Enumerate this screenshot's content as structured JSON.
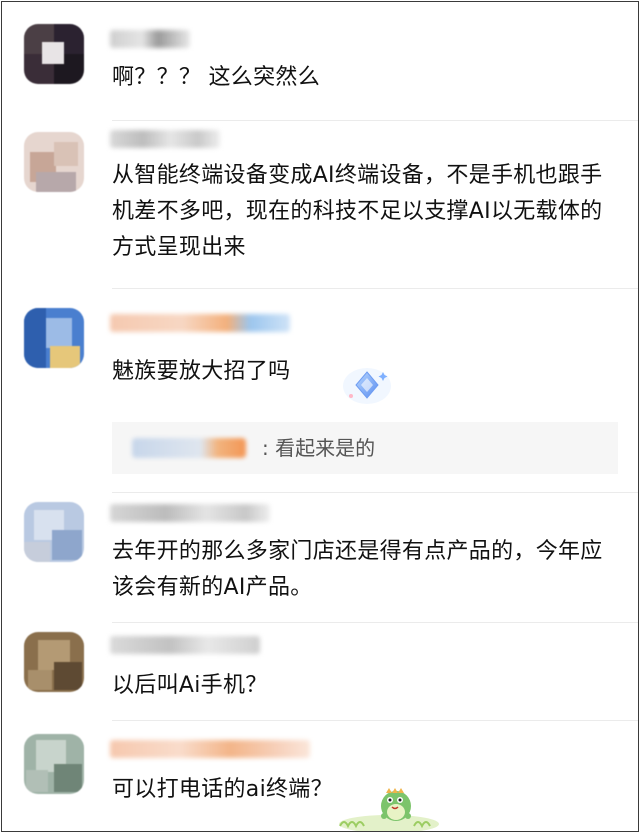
{
  "comments": [
    {
      "id": "c1",
      "text": "啊？？？ 这么突然么"
    },
    {
      "id": "c2",
      "text": "从智能终端设备变成AI终端设备，不是手机也跟手机差不多吧，现在的科技不足以支撑AI以无载体的方式呈现出来"
    },
    {
      "id": "c3",
      "text": "魅族要放大招了吗",
      "reply": {
        "text": ": 看起来是的"
      }
    },
    {
      "id": "c4",
      "text": "去年开的那么多家门店还是得有点产品的，今年应该会有新的AI产品。"
    },
    {
      "id": "c5",
      "text": "以后叫Ai手机？"
    },
    {
      "id": "c6",
      "text": "可以打电话的ai终端？"
    }
  ],
  "icons": {
    "badge": "diamond-sparkle-icon",
    "sticker": "green-dinosaur-sticker-icon"
  },
  "colors": {
    "accent_orange": "#f39655",
    "reply_bg": "#f6f6f6",
    "divider": "#ebebeb"
  }
}
